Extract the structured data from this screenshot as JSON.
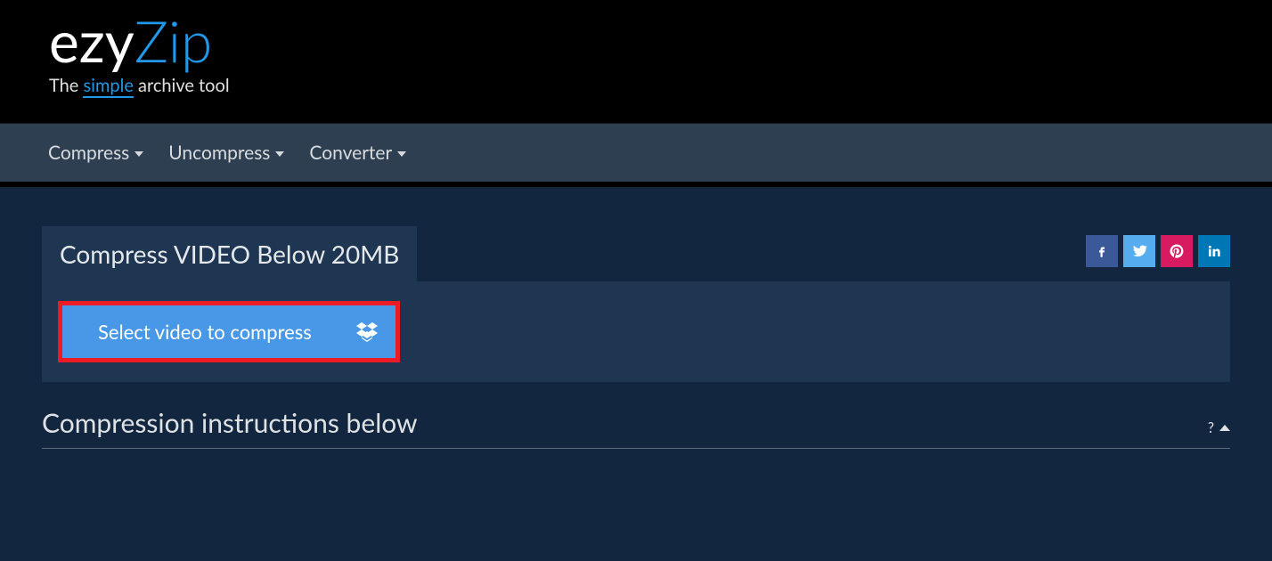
{
  "logo": {
    "part1": "ezy",
    "part2": "Zip",
    "tag_pre": "The ",
    "tag_em": "simple",
    "tag_post": " archive tool"
  },
  "nav": {
    "compress": "Compress",
    "uncompress": "Uncompress",
    "converter": "Converter"
  },
  "page": {
    "title": "Compress VIDEO Below 20MB"
  },
  "actions": {
    "select_video": "Select video to compress"
  },
  "instructions": {
    "title": "Compression instructions below",
    "toggle": "?"
  },
  "icons": {
    "facebook": "facebook-icon",
    "twitter": "twitter-icon",
    "pinterest": "pinterest-icon",
    "linkedin": "linkedin-icon",
    "dropbox": "dropbox-icon"
  }
}
